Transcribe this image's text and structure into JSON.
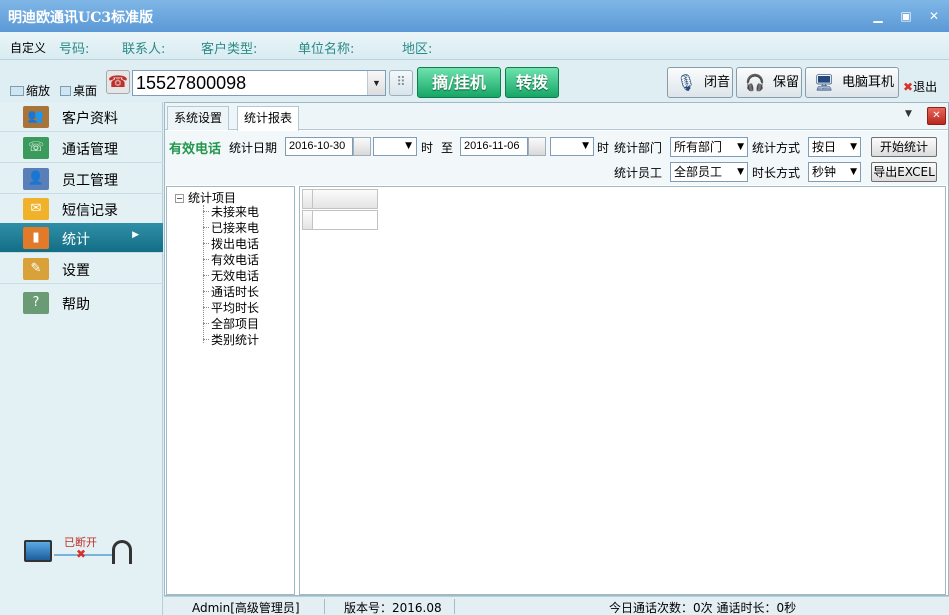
{
  "window": {
    "title": "明迪欧通讯UC3标准版",
    "controls": [
      "minimize",
      "maximize",
      "close"
    ]
  },
  "info_bar": {
    "custom": "自定义",
    "labels": [
      "号码:",
      "联系人:",
      "客户类型:",
      "单位名称:",
      "地区:"
    ]
  },
  "toolbar": {
    "zoom_label": "缩放",
    "desktop_label": "桌面",
    "phone_number": "15527800098",
    "hook_button": "摘/挂机",
    "transfer_button": "转拨",
    "mute_button": "闭音",
    "hold_button": "保留",
    "pc_headset_button": "电脑耳机",
    "exit_label": "退出"
  },
  "sidebar": {
    "items": [
      {
        "label": "客户资料",
        "icon": "contacts-icon"
      },
      {
        "label": "通话管理",
        "icon": "call-manage-icon"
      },
      {
        "label": "员工管理",
        "icon": "staff-icon"
      },
      {
        "label": "短信记录",
        "icon": "envelope-icon"
      },
      {
        "label": "统计",
        "icon": "bar-chart-icon",
        "active": true
      },
      {
        "label": "设置",
        "icon": "settings-icon"
      },
      {
        "label": "帮助",
        "icon": "help-icon"
      }
    ],
    "connection_status": "已断开"
  },
  "tabs": [
    {
      "label": "系统设置",
      "active": false
    },
    {
      "label": "统计报表",
      "active": true
    }
  ],
  "filters": {
    "heading": "有效电话",
    "date_label": "统计日期",
    "start_date": "2016-10-30",
    "hour_label": "时",
    "to_label": "至",
    "end_date": "2016-11-06",
    "hour_label2": "时",
    "dept_label": "统计部门",
    "dept_value": "所有部门",
    "method_label": "统计方式",
    "method_value": "按日",
    "start_button": "开始统计",
    "staff_label": "统计员工",
    "staff_value": "全部员工",
    "duration_label": "时长方式",
    "duration_value": "秒钟",
    "export_button": "导出EXCEL"
  },
  "tree": {
    "root": "统计项目",
    "items": [
      "未接来电",
      "已接来电",
      "拨出电话",
      "有效电话",
      "无效电话",
      "通话时长",
      "平均时长",
      "全部项目",
      "类别统计"
    ]
  },
  "status_bar": {
    "user": "Admin[高级管理员]",
    "version": "版本号：2016.08",
    "today": "今日通话次数：0次 通话时长：0秒"
  }
}
